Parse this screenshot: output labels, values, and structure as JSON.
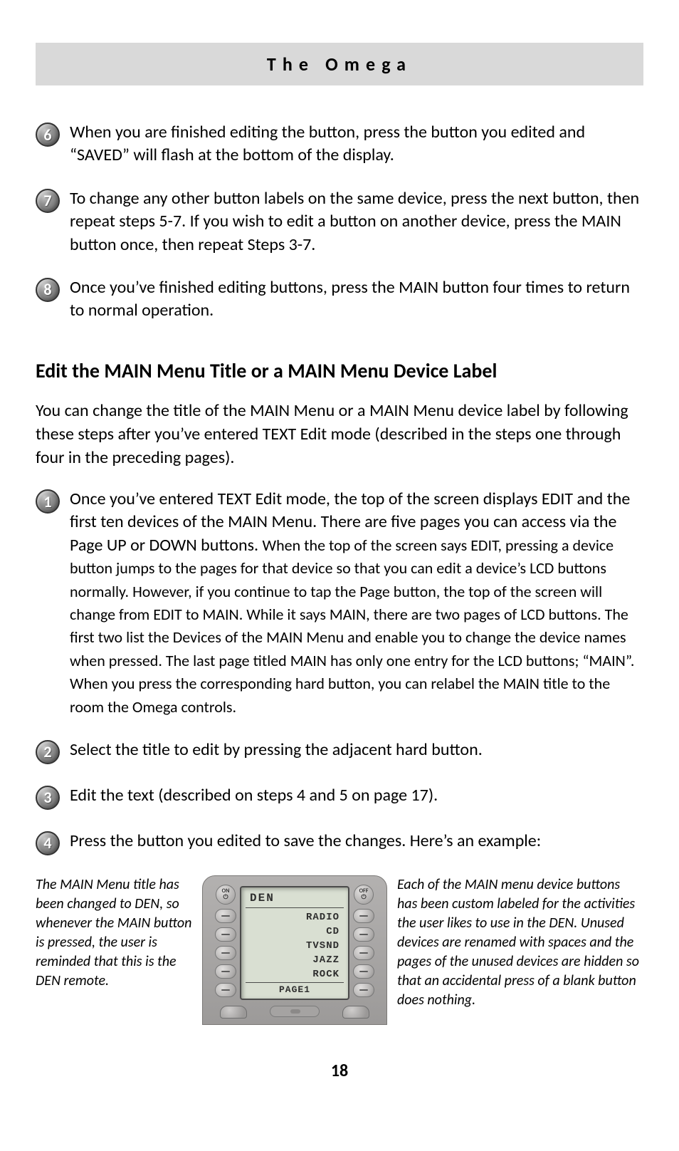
{
  "header": {
    "title": "The Omega"
  },
  "steps_a": [
    {
      "num": "6",
      "text": "When you are finished editing the button, press the button you edited and “SAVED” will flash at the bottom of the display."
    },
    {
      "num": "7",
      "text": "To change any other button labels on the same device, press the next button, then repeat steps 5-7. If you wish to edit a button on another device, press the MAIN button once, then repeat Steps 3-7."
    },
    {
      "num": "8",
      "text": "Once you’ve finished editing buttons, press the MAIN button four times to return to normal operation."
    }
  ],
  "section_title": "Edit the MAIN Menu Title or a MAIN Menu Device Label",
  "intro": "You can change the title of the MAIN Menu or a MAIN Menu device label by following these steps after you’ve entered TEXT Edit mode (described in the steps one through four in the preceding pages).",
  "steps_b": [
    {
      "num": "1",
      "text_large": "Once you’ve entered TEXT Edit mode, the top of the screen displays EDIT and the first ten devices of the MAIN Menu. There are five pages you can access via the Page UP or DOWN buttons. ",
      "text_small": "When the top of the screen says EDIT, pressing a device button jumps to the pages for that device so that you can edit a device’s LCD buttons normally. However, if you continue to tap the Page button, the top of the screen will change from EDIT to MAIN. While it says MAIN, there are two pages of LCD buttons. The first two list the Devices of the MAIN Menu and enable you to change the device names when pressed. The last page titled MAIN has only one entry for the LCD buttons; “MAIN”. When you press the corresponding hard button, you can relabel the MAIN title to the room the Omega controls."
    },
    {
      "num": "2",
      "text": "Select the title to edit by pressing the adjacent hard button."
    },
    {
      "num": "3",
      "text": "Edit the text (described on steps 4 and 5 on page 17)."
    },
    {
      "num": "4",
      "text": "Press the button you edited to save the changes. Here’s an example:"
    }
  ],
  "example": {
    "left_caption": "The MAIN Menu title has been changed to DEN, so whenever the MAIN button is pressed, the user is reminded that this is the DEN remote.",
    "right_caption": "Each of the MAIN menu device buttons has been custom labeled for the activities the user likes to use in the DEN. Unused devices are renamed with spaces and the pages of the unused devices are hidden so that an accidental press of a blank button does nothing."
  },
  "remote": {
    "on_label": "ON",
    "off_label": "OFF",
    "lcd_title": "DEN",
    "rows": [
      "RADIO",
      "CD",
      "TVSND",
      "JAZZ",
      "ROCK"
    ],
    "footer": "PAGE1"
  },
  "page_number": "18"
}
